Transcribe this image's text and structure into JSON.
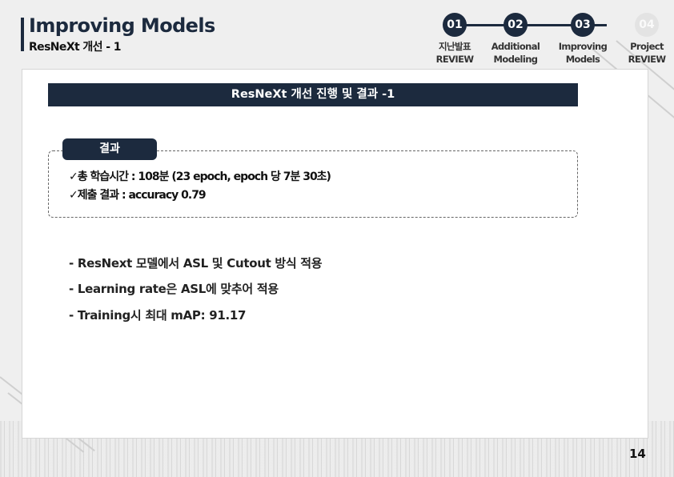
{
  "header": {
    "title": "Improving Models",
    "subtitle": "ResNeXt 개선 - 1"
  },
  "steps": [
    {
      "number": "01",
      "label_line1": "지난발표",
      "label_line2": "REVIEW",
      "active": true
    },
    {
      "number": "02",
      "label_line1": "Additional",
      "label_line2": "Modeling",
      "active": true
    },
    {
      "number": "03",
      "label_line1": "Improving",
      "label_line2": "Models",
      "active": true
    },
    {
      "number": "04",
      "label_line1": "Project",
      "label_line2": "REVIEW",
      "active": false
    }
  ],
  "banner": {
    "text": "ResNeXt 개선 진행 및 결과 -1"
  },
  "result_box": {
    "tag": "결과",
    "lines": [
      "✓총 학습시간 : 108분 (23 epoch, epoch 당 7분 30초)",
      "✓제출 결과 : accuracy 0.79"
    ]
  },
  "bullets": [
    "- ResNext 모델에서 ASL 및 Cutout 방식 적용",
    "- Learning rate은 ASL에 맞추어 적용",
    "- Training시 최대 mAP: 91.17"
  ],
  "page_number": "14",
  "colors": {
    "navy": "#1c2a3e",
    "inactive": "#e3e3e3"
  }
}
